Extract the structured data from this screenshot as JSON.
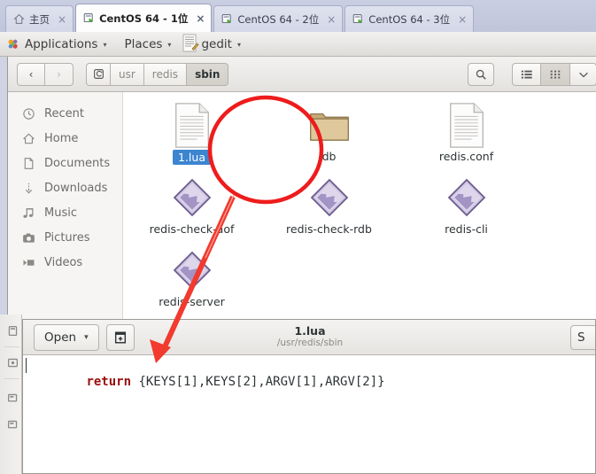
{
  "vmware": {
    "tabs": [
      {
        "label": "主页",
        "icon": "home-icon",
        "active": false,
        "close": "×"
      },
      {
        "label": "CentOS 64 - 1位",
        "icon": "vm-icon",
        "active": true,
        "close": "×"
      },
      {
        "label": "CentOS 64 - 2位",
        "icon": "vm-icon",
        "active": false,
        "close": "×"
      },
      {
        "label": "CentOS 64 - 3位",
        "icon": "vm-icon",
        "active": false,
        "close": "×"
      }
    ]
  },
  "gnome_panel": {
    "applications": "Applications",
    "places": "Places",
    "gedit": "gedit",
    "caret": "▾"
  },
  "nautilus": {
    "nav": {
      "back": "‹",
      "forward": "›"
    },
    "breadcrumbs": [
      {
        "label": "usr",
        "current": false
      },
      {
        "label": "redis",
        "current": false
      },
      {
        "label": "sbin",
        "current": true
      }
    ],
    "tools": {
      "search": "search-icon",
      "list_view": "list-view-icon",
      "grid_view": "grid-view-icon",
      "menu": "chevron-down-icon"
    },
    "sidebar": [
      {
        "label": "Recent",
        "icon": "clock-icon"
      },
      {
        "label": "Home",
        "icon": "home-icon"
      },
      {
        "label": "Documents",
        "icon": "document-icon"
      },
      {
        "label": "Downloads",
        "icon": "download-icon"
      },
      {
        "label": "Music",
        "icon": "music-icon"
      },
      {
        "label": "Pictures",
        "icon": "camera-icon"
      },
      {
        "label": "Videos",
        "icon": "video-icon"
      }
    ],
    "files": [
      {
        "name": "1.lua",
        "type": "text-file",
        "selected": true
      },
      {
        "name": "db",
        "type": "folder",
        "selected": false
      },
      {
        "name": "redis.conf",
        "type": "text-file",
        "selected": false
      },
      {
        "name": "redis-check-aof",
        "type": "executable",
        "selected": false
      },
      {
        "name": "redis-check-rdb",
        "type": "executable",
        "selected": false
      },
      {
        "name": "redis-cli",
        "type": "executable",
        "selected": false
      },
      {
        "name": "redis-server",
        "type": "executable",
        "selected": false
      }
    ]
  },
  "gedit": {
    "open_label": "Open",
    "open_caret": "▾",
    "new_tab_icon": "new-document-icon",
    "title": "1.lua",
    "subtitle": "/usr/redis/sbin",
    "save_label": "S",
    "code": {
      "keyword": "return",
      "rest": " {KEYS[1],KEYS[2],ARGV[1],ARGV[2]}"
    }
  },
  "annotation": {
    "circle_color": "#ee1c1c",
    "arrow_color": "#f23a2e"
  }
}
